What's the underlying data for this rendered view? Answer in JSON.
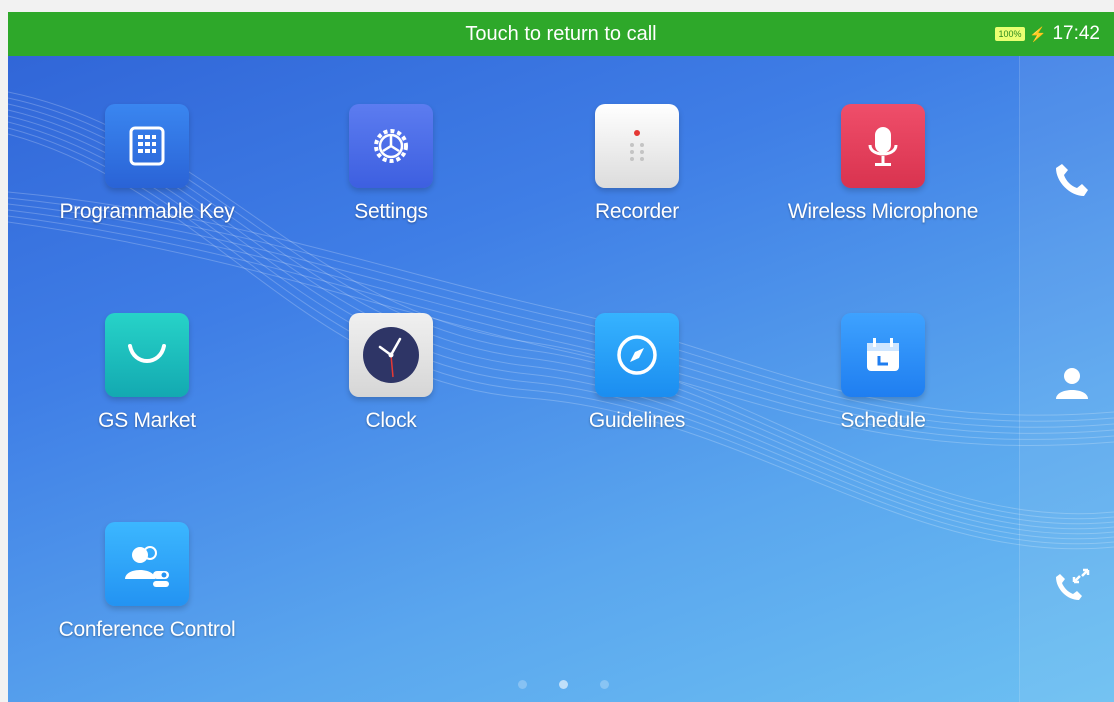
{
  "status_bar": {
    "title": "Touch to return to call",
    "battery": "100%",
    "time": "17:42",
    "color": "#2ea82a"
  },
  "apps": [
    {
      "label": "Programmable Key",
      "icon": "programmable-key-icon"
    },
    {
      "label": "Settings",
      "icon": "settings-gear-icon"
    },
    {
      "label": "Recorder",
      "icon": "recorder-icon"
    },
    {
      "label": "Wireless Microphone",
      "icon": "microphone-icon"
    },
    {
      "label": "GS Market",
      "icon": "shopping-bag-icon"
    },
    {
      "label": "Clock",
      "icon": "clock-icon"
    },
    {
      "label": "Guidelines",
      "icon": "compass-icon"
    },
    {
      "label": "Schedule",
      "icon": "calendar-icon"
    },
    {
      "label": "Conference Control",
      "icon": "conference-control-icon"
    }
  ],
  "dock": [
    {
      "icon": "phone-icon"
    },
    {
      "icon": "contacts-icon"
    },
    {
      "icon": "call-history-icon"
    }
  ],
  "page_indicator": {
    "pages": 3,
    "current": 2
  }
}
